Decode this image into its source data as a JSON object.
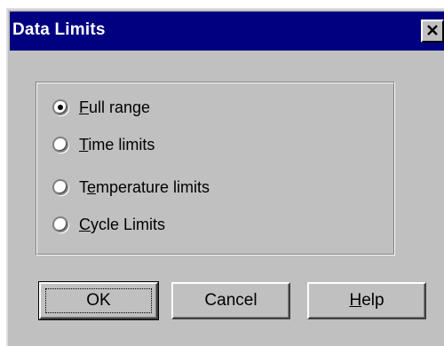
{
  "window": {
    "title": "Data Limits",
    "close_label": "Close"
  },
  "range_options": [
    {
      "label_first": "F",
      "label_rest": "ull range",
      "selected": true
    },
    {
      "label_first": "T",
      "label_rest": "ime limits",
      "selected": false
    },
    {
      "label_first": "T",
      "label_mid": "e",
      "label_rest": "mperature limits",
      "selected": false
    },
    {
      "label_first": "C",
      "label_rest": "ycle Limits",
      "selected": false
    }
  ],
  "buttons": {
    "ok": "OK",
    "cancel": "Cancel",
    "help_first": "H",
    "help_rest": "elp"
  }
}
